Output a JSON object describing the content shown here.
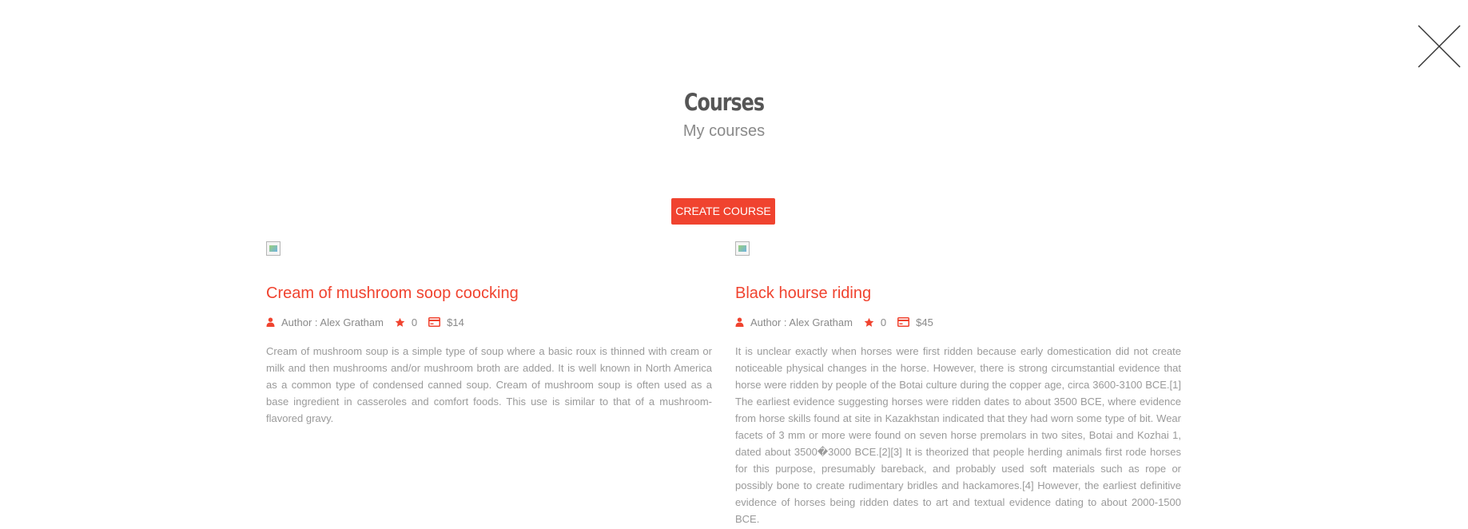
{
  "header": {
    "title": "Courses",
    "subtitle": "My courses"
  },
  "actions": {
    "create_label": "CREATE COURSE"
  },
  "colors": {
    "accent": "#f0432f",
    "title_text": "#555555",
    "muted_text": "#9a9a9a"
  },
  "courses": [
    {
      "title": "Cream of mushroom soop coocking",
      "author": "Author : Alex Gratham",
      "rating": "0",
      "price": "$14",
      "description": "Cream of mushroom soup is a simple type of soup where a basic roux is thinned with cream or milk and then mushrooms and/or mushroom broth are added. It is well known in North America as a common type of condensed canned soup. Cream of mushroom soup is often used as a base ingredient in casseroles and comfort foods. This use is similar to that of a mushroom-flavored gravy."
    },
    {
      "title": "Black hourse riding",
      "author": "Author : Alex Gratham",
      "rating": "0",
      "price": "$45",
      "description": "It is unclear exactly when horses were first ridden because early domestication did not create noticeable physical changes in the horse. However, there is strong circumstantial evidence that horse were ridden by people of the Botai culture during the copper age, circa 3600-3100 BCE.[1] The earliest evidence suggesting horses were ridden dates to about 3500 BCE, where evidence from horse skills found at site in Kazakhstan indicated that they had worn some type of bit. Wear facets of 3 mm or more were found on seven horse premolars in two sites, Botai and Kozhai 1, dated about 3500�3000 BCE.[2][3] It is theorized that people herding animals first rode horses for this purpose, presumably bareback, and probably used soft materials such as rope or possibly bone to create rudimentary bridles and hackamores.[4] However, the earliest definitive evidence of horses being ridden dates to art and textual evidence dating to about 2000-1500 BCE."
    }
  ],
  "icons": {
    "close": "close-icon",
    "author": "user-icon",
    "rating": "star-icon",
    "price": "credit-card-icon",
    "thumbnail": "broken-image-icon"
  }
}
